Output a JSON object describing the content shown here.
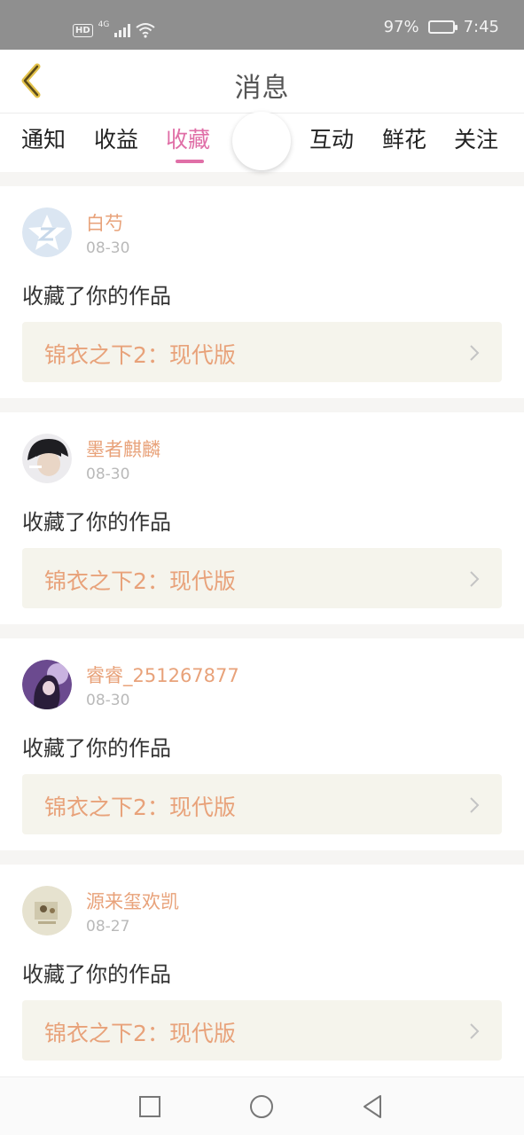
{
  "status_bar": {
    "hd": "HD",
    "network": "4G",
    "battery_percent": "97%",
    "battery_level": 0.97,
    "time": "7:45"
  },
  "header": {
    "title": "消息",
    "back_icon": "chevron-left-icon"
  },
  "tabs": {
    "items": [
      {
        "label": "通知",
        "active": false
      },
      {
        "label": "收益",
        "active": false
      },
      {
        "label": "收藏",
        "active": true
      },
      {
        "label": "互动",
        "active": false
      },
      {
        "label": "鲜花",
        "active": false
      },
      {
        "label": "关注",
        "active": false
      }
    ],
    "accent_color": "#e06fa7"
  },
  "feed": {
    "items": [
      {
        "username": "白芍",
        "date": "08-30",
        "action": "收藏了你的作品",
        "work_title": "锦衣之下2：现代版",
        "avatar": "default-star-avatar"
      },
      {
        "username": "墨者麒麟",
        "date": "08-30",
        "action": "收藏了你的作品",
        "work_title": "锦衣之下2：现代版",
        "avatar": "photo-avatar"
      },
      {
        "username": "睿睿_251267877",
        "date": "08-30",
        "action": "收藏了你的作品",
        "work_title": "锦衣之下2：现代版",
        "avatar": "photo-avatar"
      },
      {
        "username": "源来玺欢凯",
        "date": "08-27",
        "action": "收藏了你的作品",
        "work_title": "锦衣之下2：现代版",
        "avatar": "photo-avatar"
      }
    ],
    "name_color": "#e8a27a"
  },
  "nav_bar": {
    "buttons": [
      "recents-square-icon",
      "home-circle-icon",
      "back-triangle-icon"
    ]
  }
}
